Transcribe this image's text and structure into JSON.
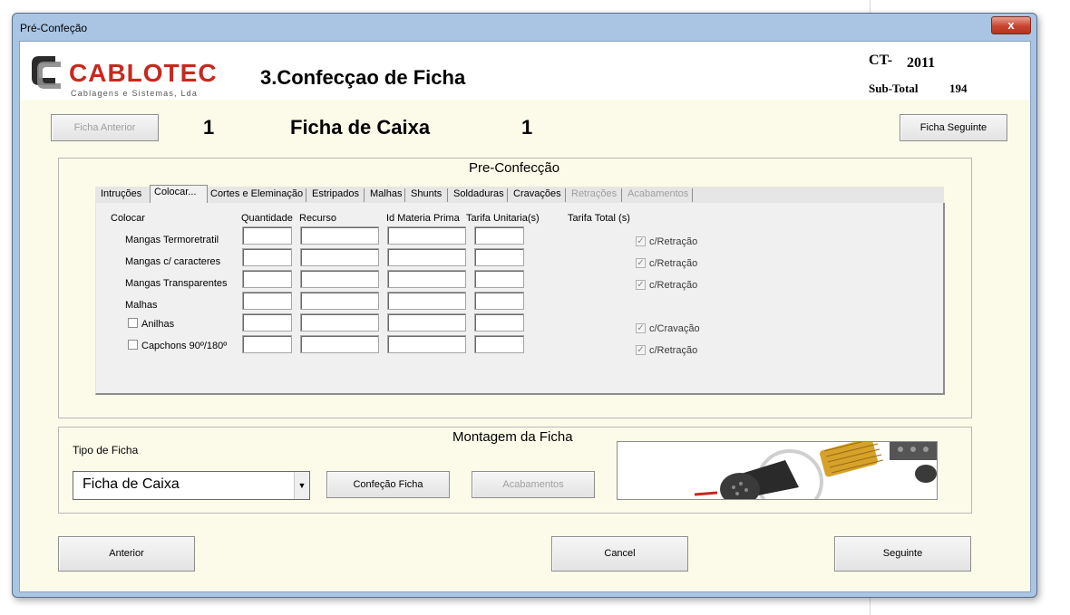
{
  "window": {
    "title": "Pré-Confeção",
    "close_glyph": "x"
  },
  "header": {
    "logo_name": "CABLOTEC",
    "logo_tagline": "Cablagens e Sistemas, Lda",
    "page_title": "3.Confecçao de Ficha",
    "ct_label": "CT-",
    "ct_value": "2011",
    "subtotal_label": "Sub-Total",
    "subtotal_value": "194"
  },
  "nav": {
    "prev_label": "Ficha Anterior",
    "next_label": "Ficha Seguinte",
    "number_left": "1",
    "ficha_title": "Ficha de Caixa",
    "number_right": "1"
  },
  "preconfeccao": {
    "title": "Pre-Confecção",
    "tabs": [
      {
        "label": "Intruções",
        "enabled": true
      },
      {
        "label": "Colocar...",
        "enabled": true,
        "active": true
      },
      {
        "label": "Cortes e Eleminação",
        "enabled": true
      },
      {
        "label": "Estripados",
        "enabled": true
      },
      {
        "label": "Malhas",
        "enabled": true
      },
      {
        "label": "Shunts",
        "enabled": true
      },
      {
        "label": "Soldaduras",
        "enabled": true
      },
      {
        "label": "Cravações",
        "enabled": true
      },
      {
        "label": "Retrações",
        "enabled": false
      },
      {
        "label": "Acabamentos",
        "enabled": false
      }
    ],
    "columns": {
      "colocar": "Colocar",
      "quantidade": "Quantidade",
      "recurso": "Recurso",
      "id_materia_prima": "Id Materia Prima",
      "tarifa_unitaria": "Tarifa Unitaria(s)",
      "tarifa_total": "Tarifa Total (s)"
    },
    "rows": [
      {
        "label": "Mangas Termoretratil",
        "has_checkbox": false,
        "option": "c/Retração"
      },
      {
        "label": "Mangas c/ caracteres",
        "has_checkbox": false,
        "option": "c/Retração"
      },
      {
        "label": "Mangas Transparentes",
        "has_checkbox": false,
        "option": "c/Retração"
      },
      {
        "label": "Malhas",
        "has_checkbox": false,
        "option": ""
      },
      {
        "label": "Anilhas",
        "has_checkbox": true,
        "checked": false,
        "option": "c/Cravação"
      },
      {
        "label": "Capchons 90º/180º",
        "has_checkbox": true,
        "checked": false,
        "option": "c/Retração"
      }
    ],
    "option_checked": true
  },
  "montagem": {
    "title": "Montagem da Ficha",
    "tipo_label": "Tipo de Ficha",
    "tipo_value": "Ficha de Caixa",
    "confeccao_button": "Confeção Ficha",
    "acabamentos_button": "Acabamentos",
    "image_icon": "connector-photo"
  },
  "footer": {
    "anterior": "Anterior",
    "cancel": "Cancel",
    "seguinte": "Seguinte"
  },
  "colors": {
    "brand_red": "#c8281e",
    "form_bg": "#fcfbe9",
    "window_frame": "#a9c5e3"
  }
}
